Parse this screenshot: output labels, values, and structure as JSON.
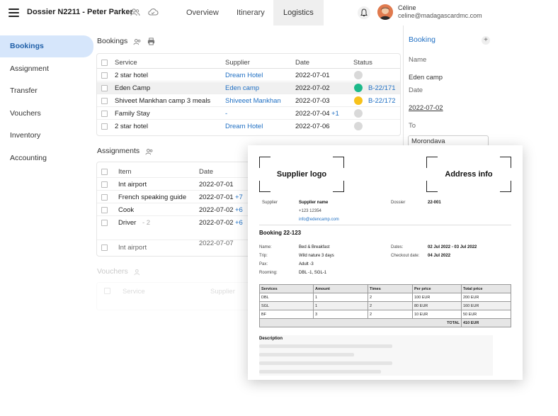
{
  "header": {
    "title": "Dossier N2211 - Peter Parker",
    "tabs": [
      "Overview",
      "Itinerary",
      "Logistics"
    ],
    "active_tab": "Logistics",
    "user_name": "Céline",
    "user_email": "celine@madagascardmc.com"
  },
  "sidebar": {
    "items": [
      "Bookings",
      "Assignment",
      "Transfer",
      "Vouchers",
      "Inventory",
      "Accounting"
    ],
    "active": "Bookings"
  },
  "bookings": {
    "title": "Bookings",
    "columns": [
      "Service",
      "Supplier",
      "Date",
      "Status"
    ],
    "rows": [
      {
        "service": "2 star hotel",
        "supplier": "Dream Hotel",
        "date": "2022-07-01",
        "extra": "",
        "status_color": "#d9d9d9",
        "status_ref": ""
      },
      {
        "service": "Eden Camp",
        "supplier": "Eden camp",
        "date": "2022-07-02",
        "extra": "",
        "status_color": "#1db98a",
        "status_ref": "B-22/171"
      },
      {
        "service": "Shiveet Mankhan camp 3 meals",
        "supplier": "Shiveeet Mankhan",
        "date": "2022-07-03",
        "extra": "",
        "status_color": "#f7c21b",
        "status_ref": "B-22/172"
      },
      {
        "service": "Family Stay",
        "supplier": "-",
        "date": "2022-07-04",
        "extra": "+1",
        "status_color": "#d9d9d9",
        "status_ref": ""
      },
      {
        "service": "2 star hotel",
        "supplier": "Dream Hotel",
        "date": "2022-07-06",
        "extra": "",
        "status_color": "#d9d9d9",
        "status_ref": ""
      }
    ]
  },
  "assignments": {
    "title": "Assignments",
    "columns": [
      "Item",
      "Date"
    ],
    "rows": [
      {
        "item": "Int airport",
        "sub": "",
        "date": "2022-07-01",
        "extra": ""
      },
      {
        "item": "French speaking guide",
        "sub": "",
        "date": "2022-07-01",
        "extra": "+7"
      },
      {
        "item": "Cook",
        "sub": "",
        "date": "2022-07-02",
        "extra": "+6"
      },
      {
        "item": "Driver",
        "sub": "-  2",
        "date": "2022-07-02",
        "extra": "+6"
      },
      {
        "item": "Int airport",
        "sub": "",
        "date": "2022-07-07",
        "extra": ""
      }
    ]
  },
  "vouchers": {
    "title": "Vouchers",
    "columns": [
      "Service",
      "Supplier"
    ]
  },
  "booking_panel": {
    "title": "Booking",
    "name_label": "Name",
    "name_value": "Eden camp",
    "date_label": "Date",
    "date_value": "2022-07-02",
    "to_label": "To",
    "to_value": "Morondava"
  },
  "voucher_doc": {
    "supplier_logo": "Supplier logo",
    "address_info": "Address info",
    "supplier_label": "Supplier",
    "supplier_name": "Supplier name",
    "supplier_phone": "+123 12354",
    "supplier_email": "info@edencamp.com",
    "dossier_label": "Dossier",
    "dossier_value": "22-001",
    "booking_title": "Booking 22-123",
    "details_left": [
      {
        "label": "Name:",
        "value": "Bed & Breakfast"
      },
      {
        "label": "Trip:",
        "value": "Wild nature 3 days"
      },
      {
        "label": "Pax:",
        "value": "Adult -3"
      },
      {
        "label": "Rooming:",
        "value": "DBL -1, SGL-1"
      }
    ],
    "details_right": [
      {
        "label": "Dates:",
        "value": "02 Jul 2022 - 03 Jul 2022"
      },
      {
        "label": "Checkout date:",
        "value": "04 Jul 2022"
      }
    ],
    "table_columns": [
      "Services",
      "Amount",
      "Times",
      "Per price",
      "Total price"
    ],
    "table_rows": [
      [
        "DBL",
        "1",
        "2",
        "100 EUR",
        "200 EUR"
      ],
      [
        "SGL",
        "1",
        "2",
        "80 EUR",
        "160 EUR"
      ],
      [
        "BF",
        "3",
        "2",
        "10 EUR",
        "50 EUR"
      ]
    ],
    "total_label": "TOTAL",
    "total_value": "410 EUR",
    "description_label": "Description"
  }
}
